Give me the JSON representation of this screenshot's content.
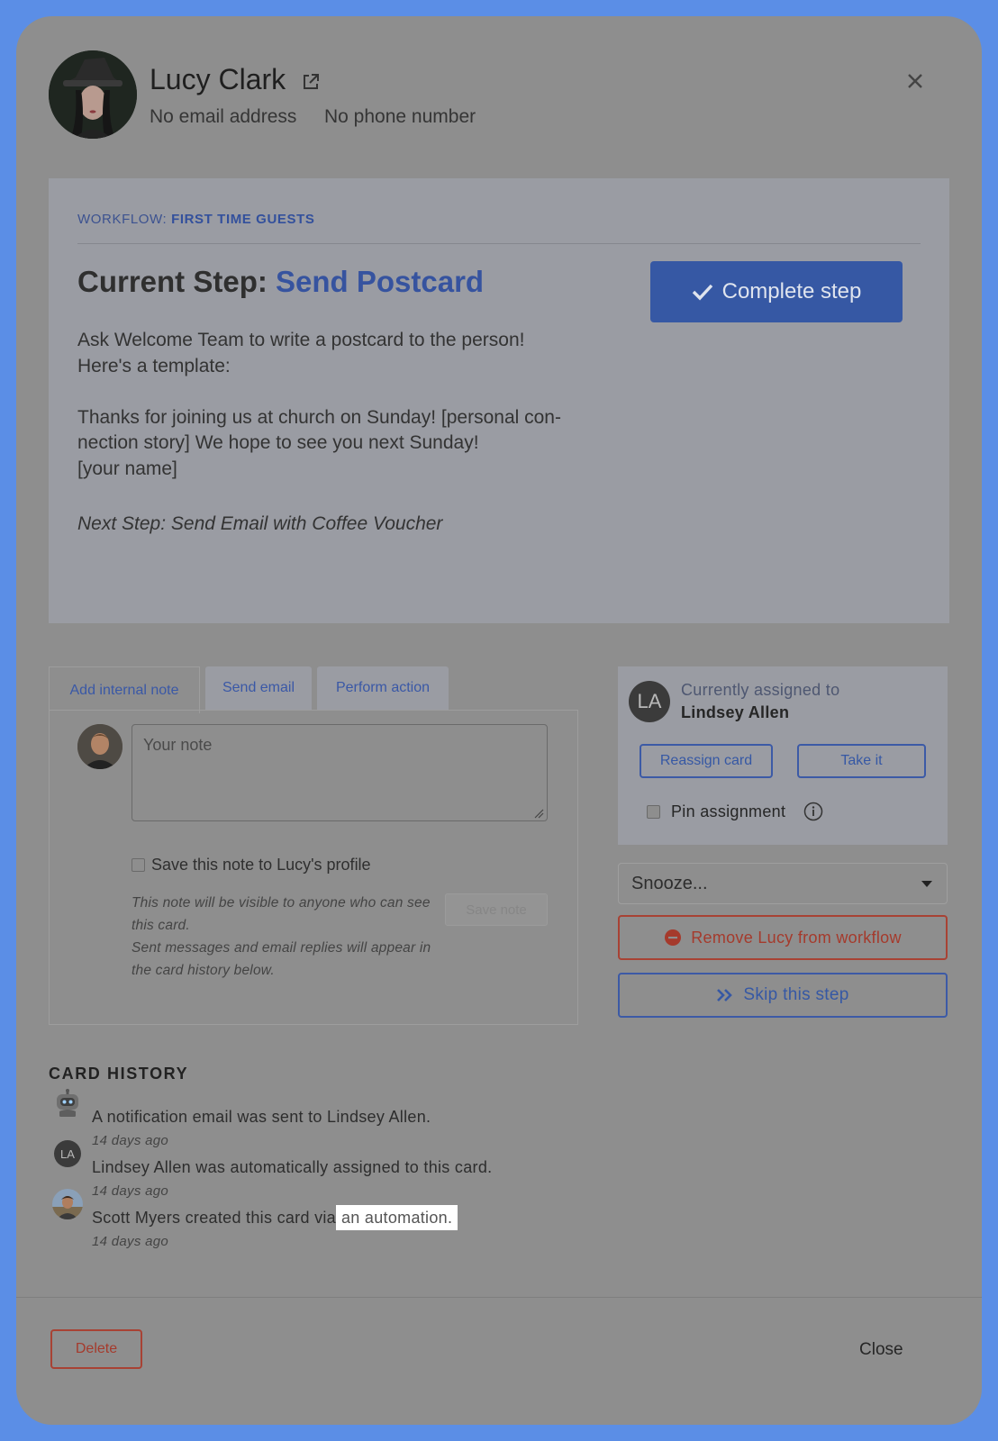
{
  "header": {
    "name": "Lucy Clark",
    "email": "No email address",
    "phone": "No phone number"
  },
  "workflow": {
    "label_prefix": "WORKFLOW:",
    "label_name": "FIRST TIME GUESTS",
    "step_prefix": "Current Step:",
    "step_name": "Send Postcard",
    "complete_label": "Complete step",
    "description": "Ask Welcome Team to write a postcard to the person!\nHere's a template:\n\nThanks for joining us at church on Sunday! [personal con-\nnection story] We hope to see you next Sunday!\n[your name]",
    "next_step": "Next Step: Send Email with Coffee Voucher"
  },
  "tabs": [
    {
      "label": "Add internal note",
      "active": true
    },
    {
      "label": "Send email",
      "active": false
    },
    {
      "label": "Perform action",
      "active": false
    }
  ],
  "note": {
    "placeholder": "Your note",
    "save_profile_label": "Save this note to Lucy's profile",
    "help_line1": "This note will be visible to anyone who can see this card.",
    "help_line2": "Sent messages and email replies will appear in the card history below.",
    "save_button": "Save note"
  },
  "assignment": {
    "initials": "LA",
    "caption": "Currently assigned to",
    "assignee": "Lindsey Allen",
    "reassign_label": "Reassign card",
    "take_label": "Take it",
    "pin_label": "Pin assignment"
  },
  "actions": {
    "snooze_label": "Snooze...",
    "remove_label": "Remove Lucy from workflow",
    "skip_label": "Skip this step"
  },
  "history": {
    "title": "CARD HISTORY",
    "items": [
      {
        "text": "A notification email was sent to Lindsey Allen.",
        "time": "14 days ago",
        "icon": "robot-icon"
      },
      {
        "text": "Lindsey Allen was automatically assigned to this card.",
        "time": "14 days ago",
        "icon": "la-avatar",
        "initials": "LA"
      },
      {
        "text": "Scott Myers created this card via",
        "link": "an automation.",
        "time": "14 days ago",
        "icon": "user-avatar"
      }
    ]
  },
  "footer": {
    "delete_label": "Delete",
    "close_label": "Close"
  },
  "colors": {
    "backdrop": "#5b8ee6",
    "modal": "#8e8e8e",
    "accent": "#3658a4",
    "danger": "#a84234"
  }
}
